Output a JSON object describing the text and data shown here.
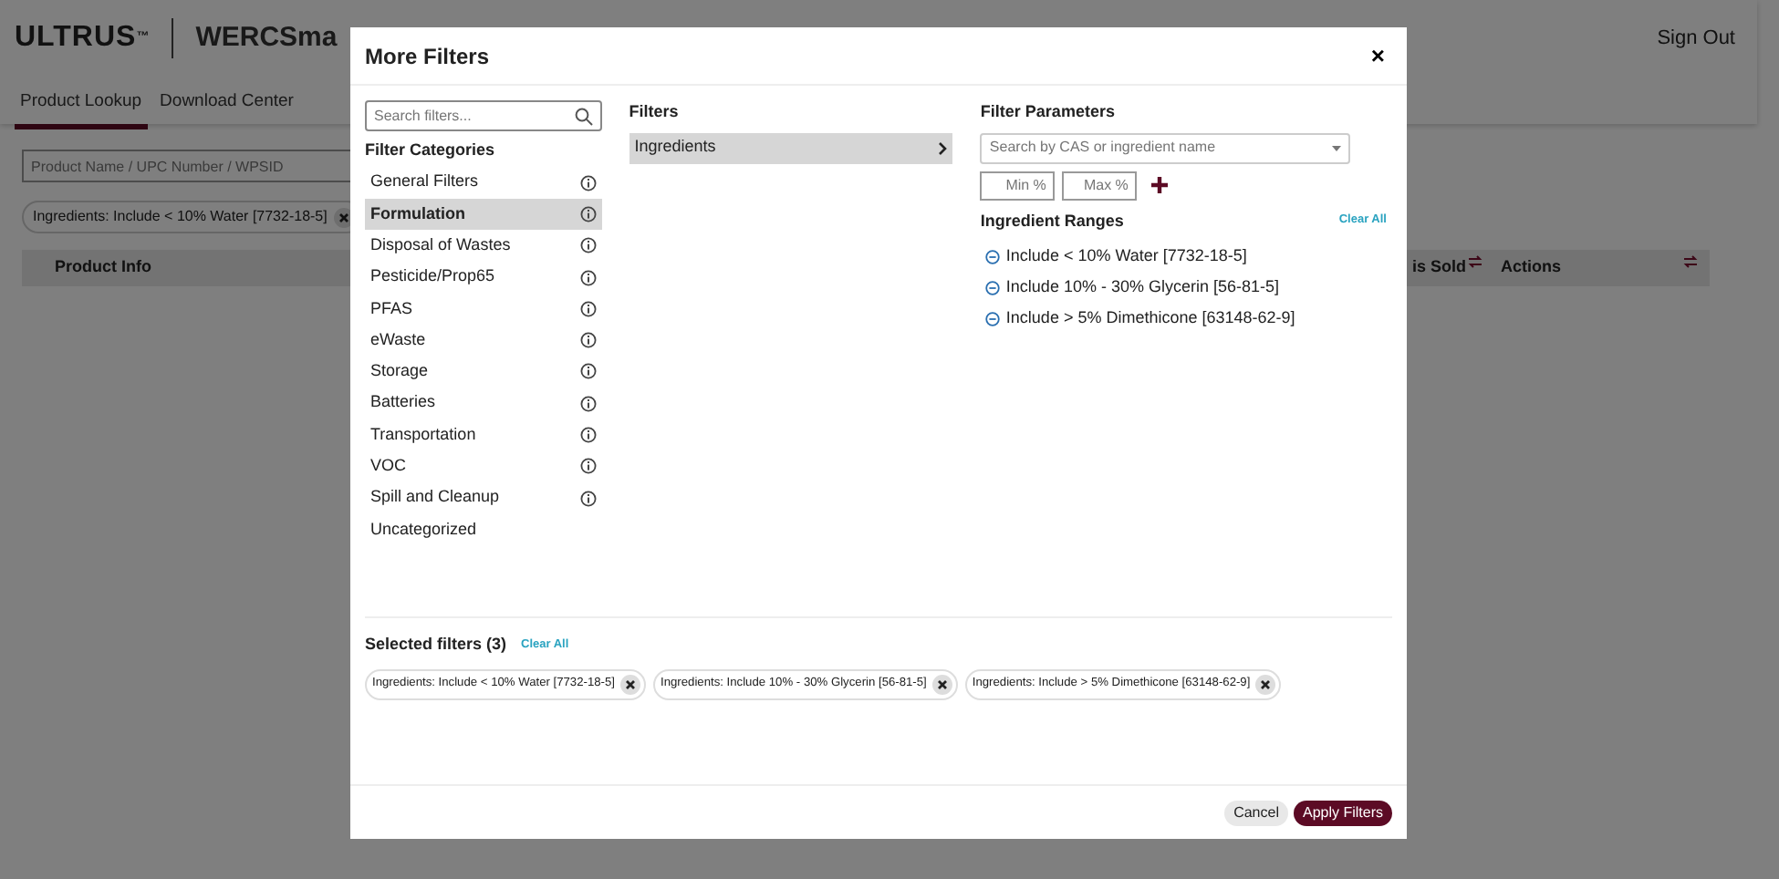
{
  "page": {
    "logo": "ULTRUS$^{™}$",
    "app_title": "WERCSma",
    "sign_out": "Sign Out",
    "tabs": [
      {
        "label": "Product Lookup",
        "selected": true
      },
      {
        "label": "Download Center",
        "selected": false
      }
    ],
    "search": {
      "placeholder": "Product Name / UPC Number / WPSID"
    },
    "chips": [
      {
        "label": "Ingredients: Include < 10% Water [7732-18-5]"
      }
    ],
    "columns": [
      {
        "label": "Product Info",
        "sortable": false
      },
      {
        "label": "is Sold",
        "sortable": true
      },
      {
        "label": "Actions",
        "sortable": false
      }
    ]
  },
  "modal": {
    "title": "More Filters",
    "close": "×",
    "search": {
      "placeholder": "Search filters..."
    },
    "categories_heading": "Filter Categories",
    "categories": [
      {
        "label": "General Filters",
        "selected": false,
        "info": true
      },
      {
        "label": "Formulation",
        "selected": true,
        "info": true
      },
      {
        "label": "Disposal of Wastes",
        "selected": false,
        "info": true
      },
      {
        "label": "Pesticide/Prop65",
        "selected": false,
        "info": true
      },
      {
        "label": "PFAS",
        "selected": false,
        "info": true
      },
      {
        "label": "eWaste",
        "selected": false,
        "info": true
      },
      {
        "label": "Storage",
        "selected": false,
        "info": true
      },
      {
        "label": "Batteries",
        "selected": false,
        "info": true
      },
      {
        "label": "Transportation",
        "selected": false,
        "info": true
      },
      {
        "label": "VOC",
        "selected": false,
        "info": true
      },
      {
        "label": "Spill and Cleanup",
        "selected": false,
        "info": true
      },
      {
        "label": "Uncategorized",
        "selected": false,
        "info": false
      }
    ],
    "filters_heading": "Filters",
    "filters": [
      {
        "label": "Ingredients",
        "selected": true
      }
    ],
    "parameters_heading": "Filter Parameters",
    "ingredient_select": {
      "placeholder": "Search by CAS or ingredient name"
    },
    "min": {
      "placeholder": "Min %"
    },
    "max": {
      "placeholder": "Max %"
    },
    "ranges_heading": "Ingredient Ranges",
    "ranges_clear": "Clear All",
    "ranges": [
      {
        "label": "Include < 10% Water [7732-18-5]"
      },
      {
        "label": "Include 10% - 30% Glycerin [56-81-5]"
      },
      {
        "label": "Include > 5% Dimethicone [63148-62-9]"
      }
    ],
    "selected_heading": "Selected filters (3)",
    "selected_clear": "Clear All",
    "selected": [
      {
        "label": "Ingredients: Include < 10% Water [7732-18-5]"
      },
      {
        "label": "Ingredients: Include 10% - 30% Glycerin [56-81-5]"
      },
      {
        "label": "Ingredients: Include > 5% Dimethicone [63148-62-9]"
      }
    ],
    "buttons": [
      {
        "label": "Cancel",
        "kind": "secondary"
      },
      {
        "label": "Apply Filters",
        "kind": "primary"
      }
    ]
  }
}
